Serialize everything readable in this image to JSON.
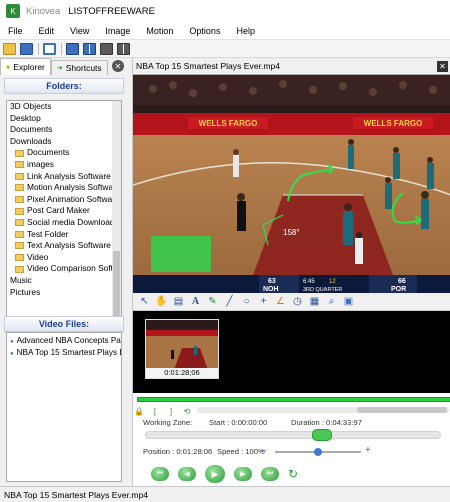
{
  "window": {
    "app_name": "Kinovea",
    "document_name": "LISTOFFREEWARE"
  },
  "menu": [
    "File",
    "Edit",
    "View",
    "Image",
    "Motion",
    "Options",
    "Help"
  ],
  "left": {
    "tabs": {
      "explorer": "Explorer",
      "shortcuts": "Shortcuts"
    },
    "folders_header": "Folders:",
    "folders": [
      {
        "label": "3D Objects",
        "child": false
      },
      {
        "label": "Desktop",
        "child": false
      },
      {
        "label": "Documents",
        "child": false
      },
      {
        "label": "Downloads",
        "child": false
      },
      {
        "label": "Documents",
        "child": true
      },
      {
        "label": "images",
        "child": true
      },
      {
        "label": "Link Analysis Software",
        "child": true
      },
      {
        "label": "Motion Analysis Software",
        "child": true
      },
      {
        "label": "Pixel Animation Software",
        "child": true
      },
      {
        "label": "Post Card Maker",
        "child": true
      },
      {
        "label": "Social media Downloader",
        "child": true
      },
      {
        "label": "Test Folder",
        "child": true
      },
      {
        "label": "Text Analysis Software",
        "child": true
      },
      {
        "label": "Video",
        "child": true
      },
      {
        "label": "Video Comparison Software",
        "child": true
      },
      {
        "label": "Music",
        "child": false
      },
      {
        "label": "Pictures",
        "child": false
      }
    ],
    "video_header": "Video Files:",
    "video_files": [
      "Advanced NBA Concepts Part",
      "NBA Top 15 Smartest Plays E"
    ]
  },
  "player": {
    "file_title": "NBA Top 15 Smartest Plays Ever.mp4",
    "overlay": {
      "banner": "WELLS FARGO",
      "angle": "158°",
      "home_team": "NOH",
      "home_score": "63",
      "quarter": "3RD QUARTER",
      "clock": "6:45",
      "shot_clock": "12",
      "away_team": "POR",
      "away_score": "66"
    },
    "keyframe_time": "0:01:28;06",
    "working_zone_label": "Working Zone:",
    "start_label": "Start : 0:00:00:00",
    "duration_label": "Duration : 0:04:33:97",
    "position_label": "Position : 0:01:28:06",
    "speed_label": "Speed : 100%",
    "speed_fraction": 0.5
  },
  "status": {
    "text": "NBA Top 15 Smartest Plays Ever.mp4"
  },
  "colors": {
    "timeline": "#2ad13c",
    "header_text": "#1a3f9a"
  }
}
